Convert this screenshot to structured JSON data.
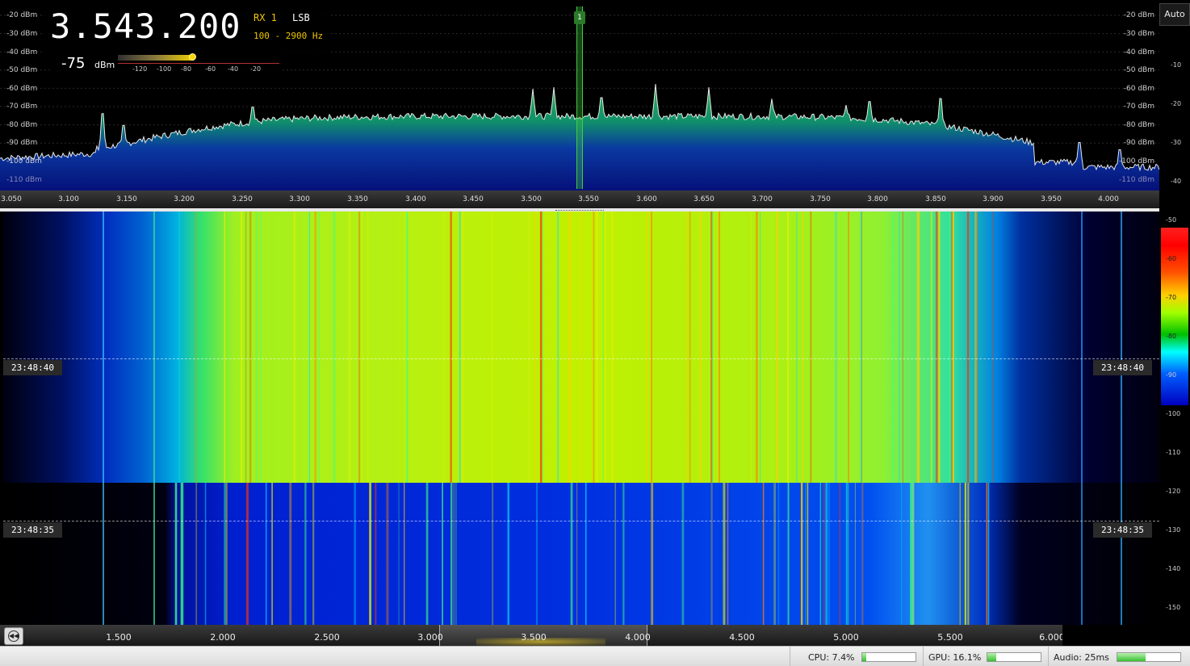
{
  "receiver": {
    "frequency": "3.543.200",
    "rx": "RX 1",
    "mode": "LSB",
    "bandwidth": "100 - 2900 Hz",
    "marker": "1"
  },
  "smeter": {
    "value": "-75",
    "unit": "dBm",
    "level_dbm": -75,
    "ticks": [
      "-120",
      "-100",
      "-80",
      "-60",
      "-40",
      "-20"
    ]
  },
  "spectrum": {
    "dbm_labels": [
      "-20 dBm",
      "-30 dBm",
      "-40 dBm",
      "-50 dBm",
      "-60 dBm",
      "-70 dBm",
      "-80 dBm",
      "-90 dBm",
      "-100 dBm",
      "-110 dBm"
    ],
    "freq_ticks": [
      "3.050",
      "3.100",
      "3.150",
      "3.200",
      "3.250",
      "3.300",
      "3.350",
      "3.400",
      "3.450",
      "3.500",
      "3.550",
      "3.600",
      "3.650",
      "3.700",
      "3.750",
      "3.800",
      "3.850",
      "3.900",
      "3.950",
      "4.000"
    ],
    "scale_labels": [
      "-10",
      "-20",
      "-30",
      "-40"
    ],
    "auto_label": "Auto"
  },
  "waterfall": {
    "time_labels": [
      "23:48:40",
      "23:48:35"
    ],
    "scale_labels": [
      "-50",
      "-60",
      "-70",
      "-80",
      "-90",
      "-100",
      "-110",
      "-120",
      "-130",
      "-140",
      "-150"
    ],
    "freq_ticks": [
      "1.500",
      "2.000",
      "2.500",
      "3.000",
      "3.500",
      "4.000",
      "4.500",
      "5.000",
      "5.500",
      "6.000"
    ]
  },
  "status": {
    "cpu": "CPU: 7.4%",
    "cpu_level": 0.074,
    "gpu": "GPU: 16.1%",
    "gpu_level": 0.161,
    "audio": "Audio: 25ms",
    "audio_level": 0.45
  },
  "colors": {
    "frequency_text": "#ffffff",
    "rx_text": "#f0c400",
    "marker": "#2a7a2a",
    "spectrum_fill_top": "#20a060",
    "spectrum_fill_bottom": "#0818a0"
  }
}
